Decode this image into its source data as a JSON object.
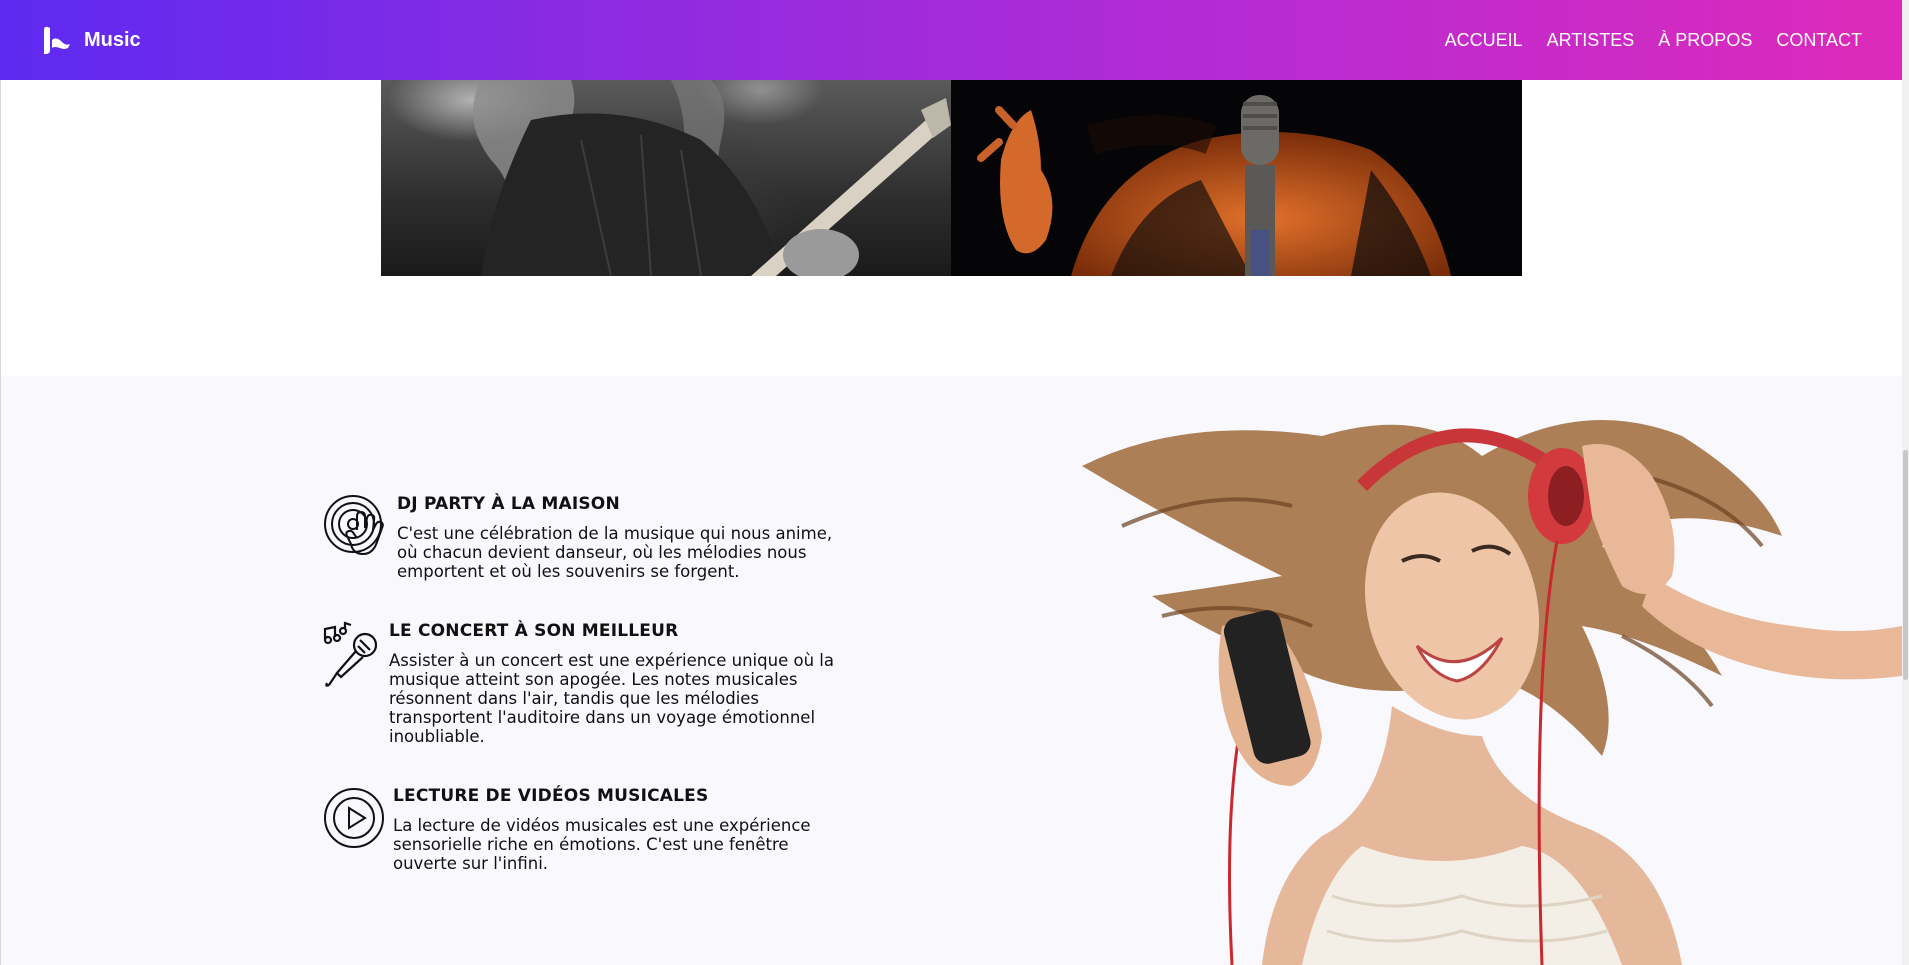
{
  "brand": {
    "name": "Music",
    "logo_icon": "music-logo-icon"
  },
  "nav": {
    "links": [
      "ACCUEIL",
      "ARTISTES",
      "À PROPOS",
      "CONTACT"
    ]
  },
  "hero": {
    "images": [
      "guitarist-photo",
      "singer-photo"
    ]
  },
  "features": [
    {
      "icon": "dj-turntable-hand-icon",
      "title": "DJ PARTY À LA MAISON",
      "description": "C'est une célébration de la musique qui nous anime, où chacun devient danseur, où les mélodies nous emportent et où les souvenirs se forgent."
    },
    {
      "icon": "microphone-music-notes-icon",
      "title": "LE CONCERT À SON MEILLEUR",
      "description": "Assister à un concert est une expérience unique où la musique atteint son apogée. Les notes musicales résonnent dans l'air, tandis que les mélodies transportent l'auditoire dans un voyage émotionnel inoubliable."
    },
    {
      "icon": "play-circle-icon",
      "title": "LECTURE DE VIDÉOS MUSICALES",
      "description": "La lecture de vidéos musicales est une expérience sensorielle riche en émotions. C'est une fenêtre ouverte sur l'infini."
    }
  ],
  "colors": {
    "nav_gradient_start": "#5d2af1",
    "nav_gradient_end": "#dd2aba",
    "section_bg": "#f8f8fd"
  }
}
